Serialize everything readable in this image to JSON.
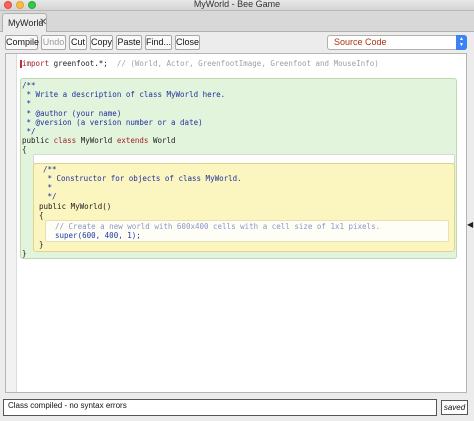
{
  "window": {
    "title": "MyWorld - Bee Game"
  },
  "tabs": [
    {
      "label": "MyWorld",
      "close": "✕"
    }
  ],
  "toolbar": {
    "compile": "Compile",
    "undo": "Undo",
    "cut": "Cut",
    "copy": "Copy",
    "paste": "Paste",
    "find": "Find...",
    "close": "Close",
    "view_select": "Source Code"
  },
  "code": {
    "import_kw": "import",
    "import_rest": " greenfoot.*;",
    "import_comment": "  // (World, Actor, GreenfootImage, Greenfoot and MouseInfo)",
    "class_doc": [
      "/**",
      " * Write a description of class MyWorld here.",
      " * ",
      " * @author (your name)",
      " * @version (a version number or a date)",
      " */"
    ],
    "class_kw_public": "public ",
    "class_kw_class": "class ",
    "class_name": "MyWorld ",
    "class_kw_extends": "extends ",
    "class_super": "World",
    "open_brace": "{",
    "close_brace": "}",
    "ctor_doc": [
      "/**",
      " * Constructor for objects of class MyWorld.",
      " * ",
      " */"
    ],
    "ctor_sig": "public MyWorld()",
    "ctor_open": "{",
    "ctor_close": "}",
    "body_comment": "// Create a new world with 600x400 cells with a cell size of 1x1 pixels.",
    "body_call": "super(600, 400, 1);"
  },
  "status": {
    "message": "Class compiled - no syntax errors",
    "saved": "saved"
  }
}
